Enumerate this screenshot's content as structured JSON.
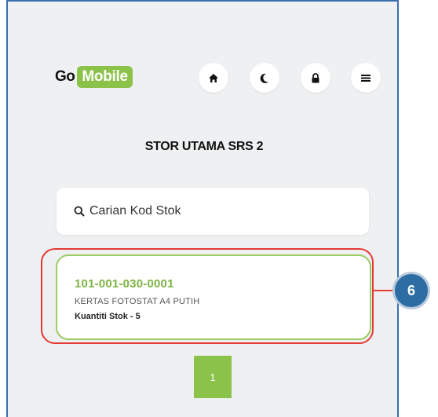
{
  "header": {
    "logo_go": "Go",
    "logo_mobile": "Mobile",
    "nav_icons": [
      "home-icon",
      "moon-icon",
      "lock-icon",
      "menu-icon"
    ]
  },
  "page": {
    "title": "STOR UTAMA SRS 2"
  },
  "search": {
    "placeholder": "Carian Kod Stok"
  },
  "results": [
    {
      "code": "101-001-030-0001",
      "description": "KERTAS FOTOSTAT A4 PUTIH",
      "quantity": "Kuantiti Stok - 5"
    }
  ],
  "annotation": {
    "number": "6",
    "color": "#e53935"
  },
  "pagination": {
    "current_page": "1"
  },
  "colors": {
    "accent": "#8bc34a",
    "callout": "#2e6da4",
    "highlight": "#e53935"
  }
}
